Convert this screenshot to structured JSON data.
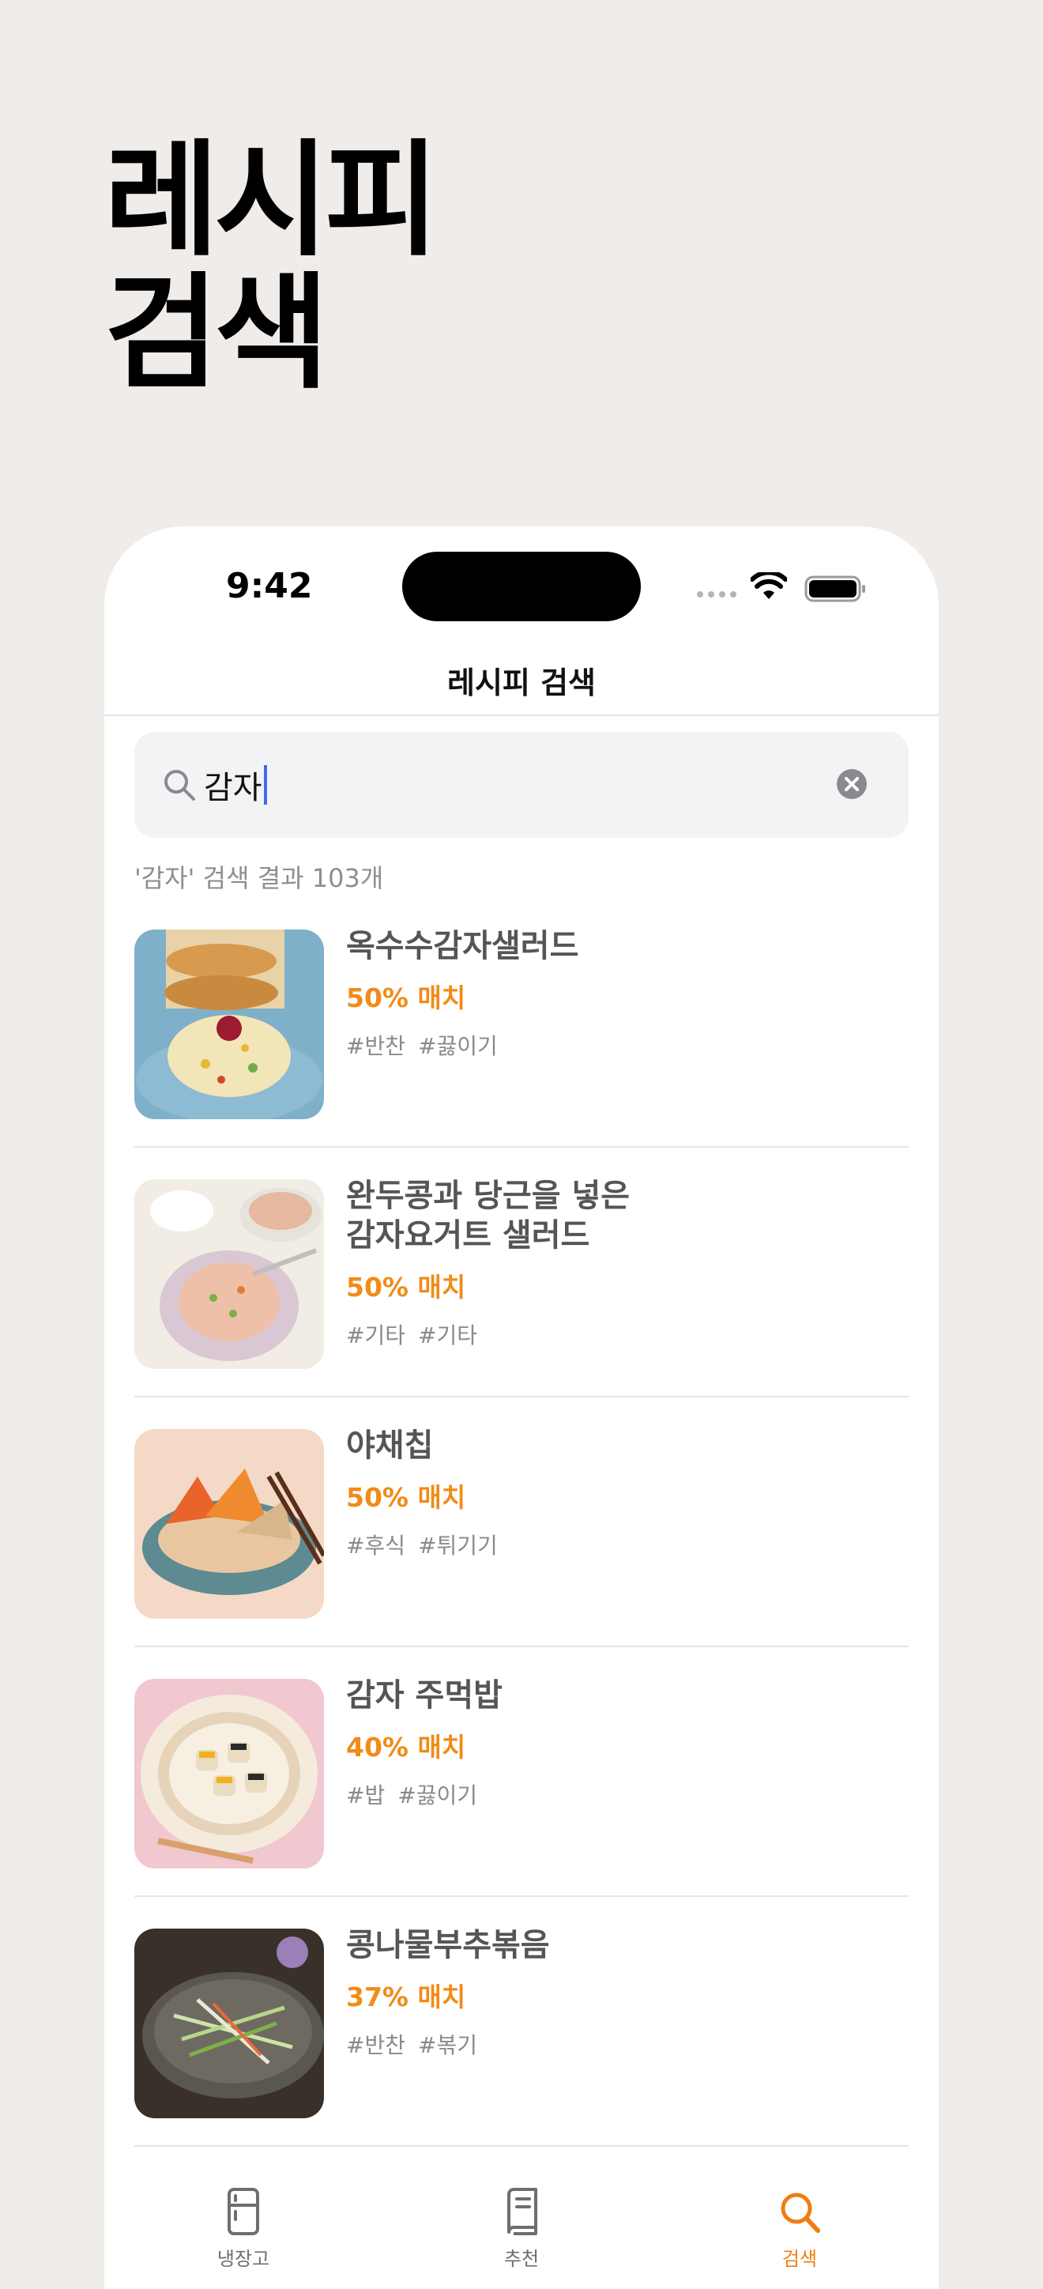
{
  "promo": {
    "title_line1": "레시피",
    "title_line2": "검색"
  },
  "status_bar": {
    "time": "9:42"
  },
  "nav": {
    "title": "레시피 검색"
  },
  "search": {
    "query": "감자",
    "result_summary": "'감자' 검색 결과 103개"
  },
  "results": [
    {
      "name": "옥수수감자샐러드",
      "match": "50% 매치",
      "tags": [
        "#반찬",
        "#끓이기"
      ]
    },
    {
      "name": "완두콩과 당근을 넣은\n감자요거트 샐러드",
      "match": "50% 매치",
      "tags": [
        "#기타",
        "#기타"
      ]
    },
    {
      "name": "야채칩",
      "match": "50% 매치",
      "tags": [
        "#후식",
        "#튀기기"
      ]
    },
    {
      "name": "감자 주먹밥",
      "match": "40% 매치",
      "tags": [
        "#밥",
        "#끓이기"
      ]
    },
    {
      "name": "콩나물부추볶음",
      "match": "37% 매치",
      "tags": [
        "#반찬",
        "#볶기"
      ]
    }
  ],
  "tab_bar": {
    "items": [
      {
        "label": "냉장고",
        "icon": "fridge-icon",
        "active": false
      },
      {
        "label": "추천",
        "icon": "book-icon",
        "active": false
      },
      {
        "label": "검색",
        "icon": "search-icon",
        "active": true
      }
    ]
  },
  "colors": {
    "background": "#EFECE9",
    "accent": "#EF7D11",
    "match_text": "#F08C18",
    "caret": "#3D6BF2"
  }
}
